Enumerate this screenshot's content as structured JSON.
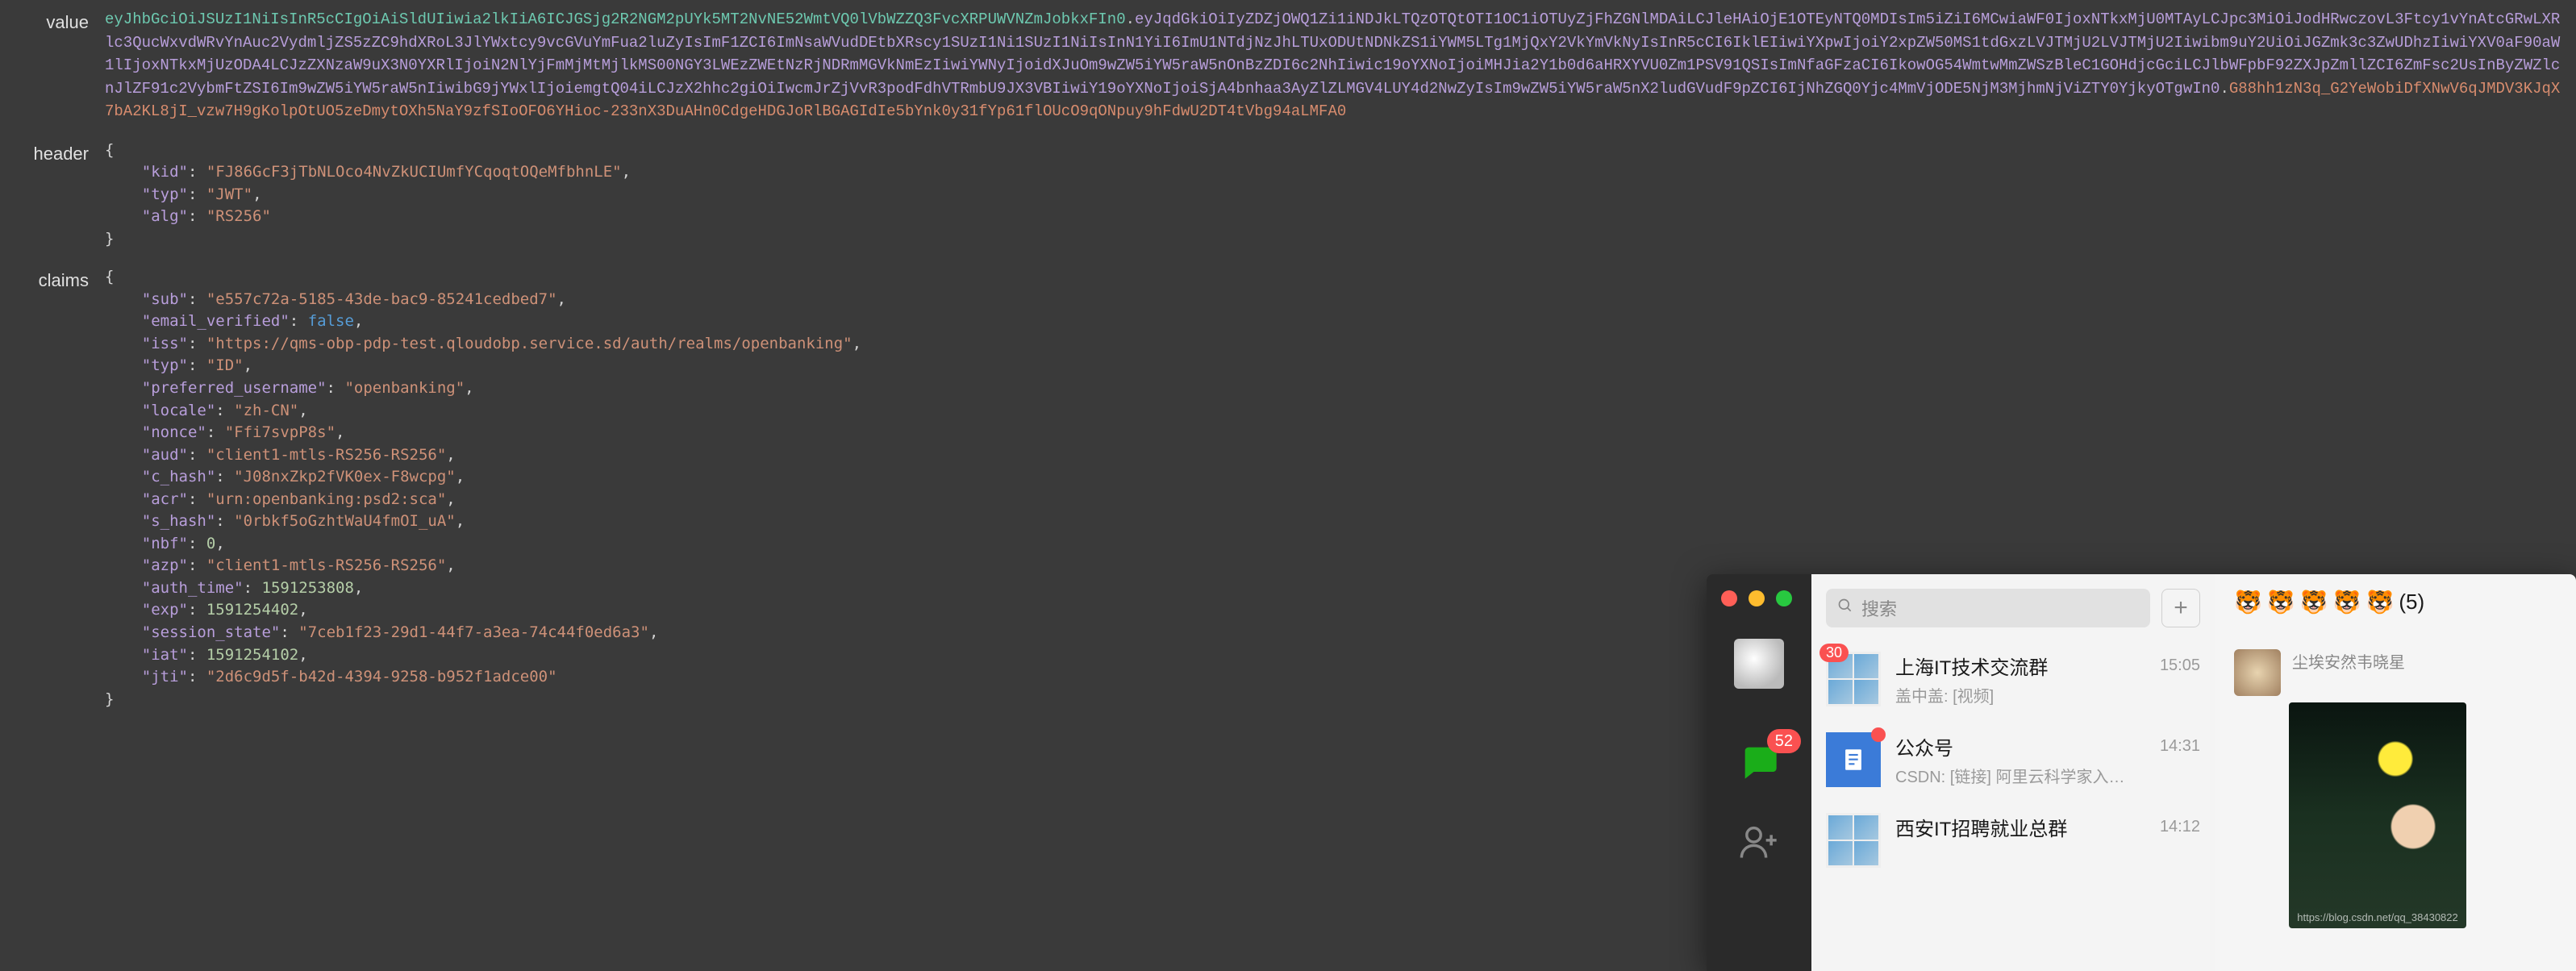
{
  "labels": {
    "value": "value",
    "header": "header",
    "claims": "claims"
  },
  "jwt": {
    "header_b64": "eyJhbGciOiJSUzI1NiIsInR5cCIgOiAiSldUIiwia2lkIiA6ICJGSjg2R2NGM2pUYk5MT2NvNE52WmtVQ0lVbWZZQ3FvcXRPUWVNZmJobkxFIn0",
    "payload_b64": "eyJqdGkiOiIyZDZjOWQ1Zi1iNDJkLTQzOTQtOTI1OC1iOTUyZjFhZGNlMDAiLCJleHAiOjE1OTEyNTQ0MDIsIm5iZiI6MCwiaWF0IjoxNTkxMjU0MTAyLCJpc3MiOiJodHRwczovL3Ftcy1vYnAtcGRwLXRlc3QucWxvdWRvYnAuc2VydmljZS5zZC9hdXRoL3JlYWxtcy9vcGVuYmFua2luZyIsImF1ZCI6ImNsaWVudDEtbXRscy1SUzI1Ni1SUzI1NiIsInN1YiI6ImU1NTdjNzJhLTUxODUtNDNkZS1iYWM5LTg1MjQxY2VkYmVkNyIsInR5cCI6IklEIiwiYXpwIjoiY2xpZW50MS1tdGxzLVJTMjU2LVJTMjU2Iiwibm9uY2UiOiJGZmk3c3ZwUDhzIiwiYXV0aF90aW1lIjoxNTkxMjUzODA4LCJzZXNzaW9uX3N0YXRlIjoiN2NlYjFmMjMtMjlkMS00NGY3LWEzZWEtNzRjNDRmMGVkNmEzIiwiYWNyIjoidXJuOm9wZW5iYW5raW5nOnBzZDI6c2NhIiwic19oYXNoIjoiMHJia2Y1b0d6aHRXYVU0Zm1PSV91QSIsImNfaGFzaCI6IkowOG54WmtwMmZWSzBleC1GOHdjcGciLCJlbWFpbF92ZXJpZmllZCI6ZmFsc2UsInByZWZlcnJlZF91c2VybmFtZSI6Im9wZW5iYW5raW5nIiwibG9jYWxlIjoiemgtQ04iLCJzX2hhc2giOiIwcmJrZjVvR3podFdhVTRmbU9JX3VBIiwiY19oYXNoIjoiSjA4bnhaa3AyZlZLMGV4LUY4d2NwZyIsIm9wZW5iYW5raW5nX2ludGVudF9pZCI6IjNhZGQ0Yjc4MmVjODE5NjM3MjhmNjViZTY0YjkyOTgwIn0",
    "signature_b64": "G88hh1zN3q_G2YeWobiDfXNwV6qJMDV3KJqX7bA2KL8jI_vzw7H9gKolpOtUO5zeDmytOXh5NaY9zfSIoOFO6YHioc-233nX3DuAHn0CdgeHDGJoRlBGAGIdIe5bYnk0y31fYp61flOUcO9qONpuy9hFdwU2DT4tVbg94aLMFA0"
  },
  "header_json": {
    "kid": "FJ86GcF3jTbNLOco4NvZkUCIUmfYCqoqtOQeMfbhnLE",
    "typ": "JWT",
    "alg": "RS256"
  },
  "claims_json": {
    "sub": "e557c72a-5185-43de-bac9-85241cedbed7",
    "email_verified": false,
    "iss": "https://qms-obp-pdp-test.qloudobp.service.sd/auth/realms/openbanking",
    "typ": "ID",
    "preferred_username": "openbanking",
    "locale": "zh-CN",
    "nonce": "Ffi7svpP8s",
    "aud": "client1-mtls-RS256-RS256",
    "c_hash": "J08nxZkp2fVK0ex-F8wcpg",
    "acr": "urn:openbanking:psd2:sca",
    "s_hash": "0rbkf5oGzhtWaU4fmOI_uA",
    "nbf": 0,
    "azp": "client1-mtls-RS256-RS256",
    "auth_time": 1591253808,
    "exp": 1591254402,
    "session_state": "7ceb1f23-29d1-44f7-a3ea-74c44f0ed6a3",
    "iat": 1591254102,
    "jti": "2d6c9d5f-b42d-4394-9258-b952f1adce00"
  },
  "wechat": {
    "search_placeholder": "搜索",
    "unread_total": "52",
    "chats": [
      {
        "title": "上海IT技术交流群",
        "preview": "盖中盖: [视频]",
        "time": "15:05",
        "badge": "30",
        "dot": false
      },
      {
        "title": "公众号",
        "preview": "CSDN: [链接] 阿里云科学家入…",
        "time": "14:31",
        "badge": null,
        "dot": true
      },
      {
        "title": "西安IT招聘就业总群",
        "preview": "",
        "time": "14:12",
        "badge": null,
        "dot": false
      }
    ],
    "active_chat": {
      "title_suffix": "(5)",
      "sender": "尘埃安然韦晓星",
      "watermark": "https://blog.csdn.net/qq_38430822"
    }
  }
}
